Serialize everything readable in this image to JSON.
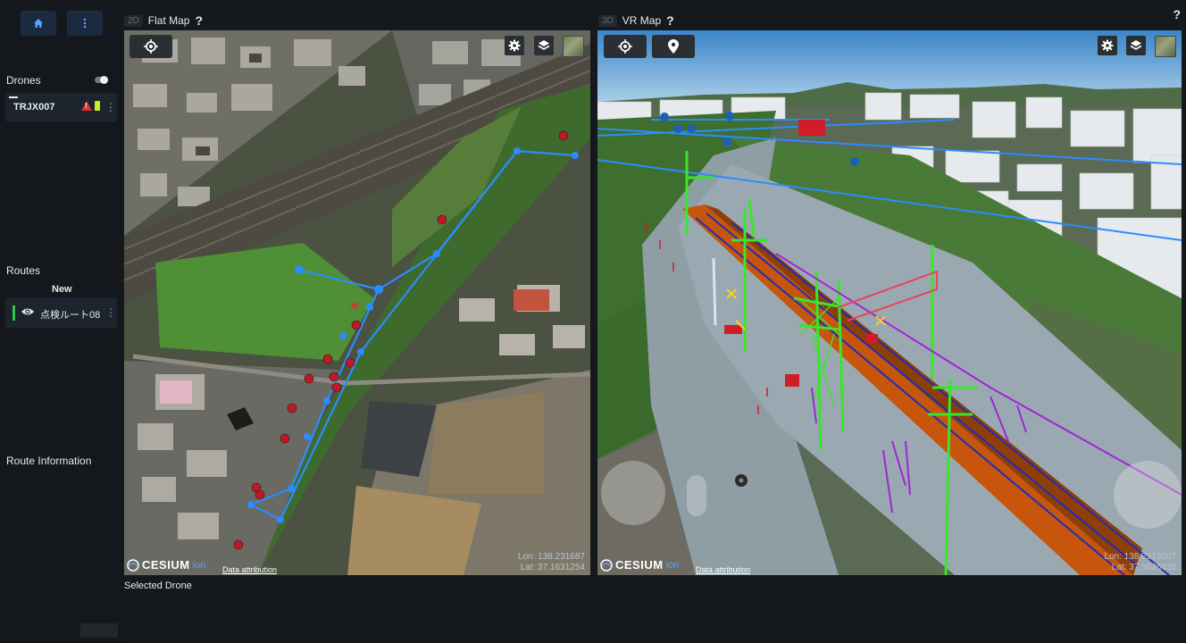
{
  "sidebar": {
    "drones_title": "Drones",
    "drone": {
      "name": "TRJX007"
    },
    "routes_title": "Routes",
    "route_new_label": "New",
    "route": {
      "name": "点検ルート08"
    },
    "route_info_title": "Route Information"
  },
  "flat_map": {
    "mode_badge": "2D",
    "title": "Flat Map",
    "help": "?",
    "attribution": "Data attribution",
    "lon": "Lon: 138.231687",
    "lat": "Lat: 37.1631254"
  },
  "vr_map": {
    "mode_badge": "3D",
    "title": "VR Map",
    "help": "?",
    "attribution": "Data attribution",
    "lon": "Lon: 138.2313207",
    "lat": "Lat: 37.1636635"
  },
  "cesium": {
    "logo": "CESIUM",
    "suffix": "ion"
  },
  "selected_drone_label": "Selected Drone",
  "global_help": "?",
  "colors": {
    "accent": "#5aa2ff",
    "route_line": "#2b8cff",
    "rail_structure": "#39e629",
    "track_bed": "#c7560c",
    "alert": "#e03131"
  }
}
